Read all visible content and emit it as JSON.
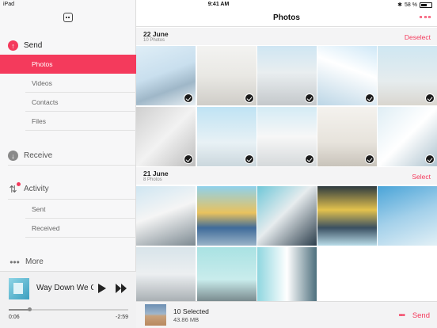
{
  "status_bar": {
    "device": "iPad",
    "wifi_icon": "wifi-icon",
    "time": "9:41 AM",
    "bluetooth_icon": "bluetooth-icon",
    "battery": "58 %"
  },
  "sidebar": {
    "top_icon": "message-icon",
    "send": {
      "label": "Send",
      "items": [
        "Photos",
        "Videos",
        "Contacts",
        "Files"
      ],
      "active": "Photos"
    },
    "receive": {
      "label": "Receive"
    },
    "activity": {
      "label": "Activity",
      "items": [
        "Sent",
        "Received"
      ]
    },
    "more": {
      "label": "More"
    }
  },
  "player": {
    "song": "Way Down We Go",
    "elapsed": "0:06",
    "remaining": "-2:59",
    "progress": 0.17
  },
  "header": {
    "title": "Photos"
  },
  "sections": [
    {
      "date": "22 June",
      "count": "10 Photos",
      "action": "Deselect"
    },
    {
      "date": "21 June",
      "count": "8 Photos",
      "action": "Select"
    }
  ],
  "bottom_bar": {
    "title": "10 Selected",
    "size": "43.86 MB",
    "send": "Send",
    "more": "•••"
  },
  "colors": {
    "accent": "#f43a5c",
    "sidebar_bg": "#f7f7f8"
  }
}
